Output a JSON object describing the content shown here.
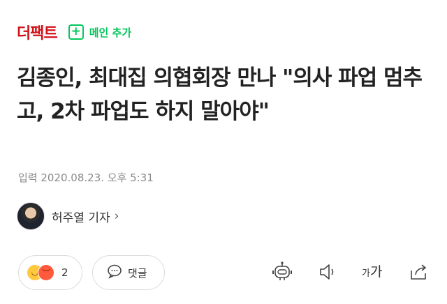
{
  "header": {
    "brand": "더팩트",
    "add_main_label": "메인 추가"
  },
  "article": {
    "title": "김종인, 최대집 의협회장 만나 \"의사 파업 멈추고, 2차 파업도 하지 말아야\"",
    "dateline": "입력 2020.08.23. 오후 5:31",
    "reporter": "허주열 기자"
  },
  "toolbar": {
    "reaction_count": "2",
    "comment_label": "댓글",
    "font_small": "가",
    "font_large": "가",
    "icons": [
      "smile-emoji-icon",
      "angry-emoji-icon",
      "comment-icon",
      "robot-summary-icon",
      "speaker-icon",
      "font-size-icon",
      "share-icon"
    ]
  },
  "colors": {
    "brand": "#d0121a",
    "accent": "#03c75a"
  }
}
